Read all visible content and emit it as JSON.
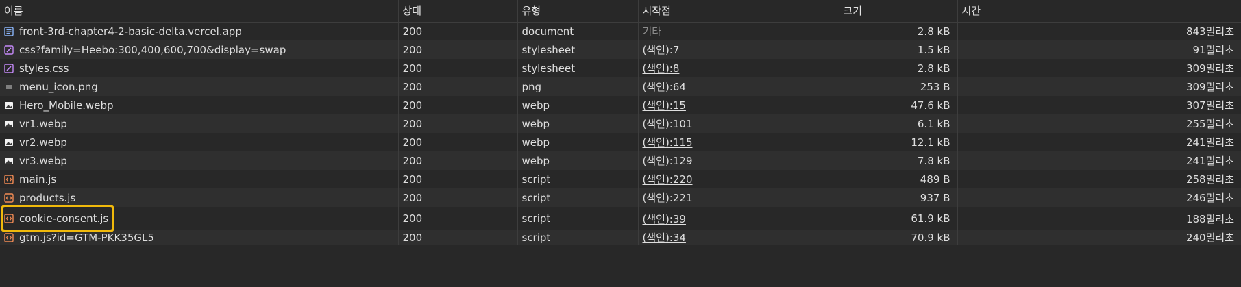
{
  "columns": {
    "name": "이름",
    "status": "상태",
    "type": "유형",
    "initiator": "시작점",
    "size": "크기",
    "time": "시간"
  },
  "rows": [
    {
      "name": "front-3rd-chapter4-2-basic-delta.vercel.app",
      "icon": "document-icon",
      "status": "200",
      "type": "document",
      "initiator": "기타",
      "initiator_link": false,
      "size": "2.8 kB",
      "time": "843밀리초"
    },
    {
      "name": "css?family=Heebo:300,400,600,700&display=swap",
      "icon": "stylesheet-icon",
      "status": "200",
      "type": "stylesheet",
      "initiator": "(색인):7",
      "initiator_link": true,
      "size": "1.5 kB",
      "time": "91밀리초"
    },
    {
      "name": "styles.css",
      "icon": "stylesheet-icon",
      "status": "200",
      "type": "stylesheet",
      "initiator": "(색인):8",
      "initiator_link": true,
      "size": "2.8 kB",
      "time": "309밀리초"
    },
    {
      "name": "menu_icon.png",
      "icon": "menu-image-icon",
      "status": "200",
      "type": "png",
      "initiator": "(색인):64",
      "initiator_link": true,
      "size": "253 B",
      "time": "309밀리초"
    },
    {
      "name": "Hero_Mobile.webp",
      "icon": "image-thumbnail-icon",
      "status": "200",
      "type": "webp",
      "initiator": "(색인):15",
      "initiator_link": true,
      "size": "47.6 kB",
      "time": "307밀리초"
    },
    {
      "name": "vr1.webp",
      "icon": "image-thumbnail-icon",
      "status": "200",
      "type": "webp",
      "initiator": "(색인):101",
      "initiator_link": true,
      "size": "6.1 kB",
      "time": "255밀리초"
    },
    {
      "name": "vr2.webp",
      "icon": "image-thumbnail-icon",
      "status": "200",
      "type": "webp",
      "initiator": "(색인):115",
      "initiator_link": true,
      "size": "12.1 kB",
      "time": "241밀리초"
    },
    {
      "name": "vr3.webp",
      "icon": "image-thumbnail-icon",
      "status": "200",
      "type": "webp",
      "initiator": "(색인):129",
      "initiator_link": true,
      "size": "7.8 kB",
      "time": "241밀리초"
    },
    {
      "name": "main.js",
      "icon": "script-icon",
      "status": "200",
      "type": "script",
      "initiator": "(색인):220",
      "initiator_link": true,
      "size": "489 B",
      "time": "258밀리초"
    },
    {
      "name": "products.js",
      "icon": "script-icon",
      "status": "200",
      "type": "script",
      "initiator": "(색인):221",
      "initiator_link": true,
      "size": "937 B",
      "time": "246밀리초"
    },
    {
      "name": "cookie-consent.js",
      "icon": "script-icon",
      "status": "200",
      "type": "script",
      "initiator": "(색인):39",
      "initiator_link": true,
      "size": "61.9 kB",
      "time": "188밀리초",
      "highlighted": true
    },
    {
      "name": "gtm.js?id=GTM-PKK35GL5",
      "icon": "script-icon",
      "status": "200",
      "type": "script",
      "initiator": "(색인):34",
      "initiator_link": true,
      "size": "70.9 kB",
      "time": "240밀리초"
    }
  ],
  "colors": {
    "background": "#282828",
    "row_alt": "#2f2f2f",
    "divider": "#3d3d3d",
    "text": "#dedede",
    "dim_text": "#8d8d8d",
    "document_icon": "#8ab4f8",
    "stylesheet_icon": "#c58af9",
    "script_icon": "#f28b54",
    "highlight": "#f0b90b"
  }
}
